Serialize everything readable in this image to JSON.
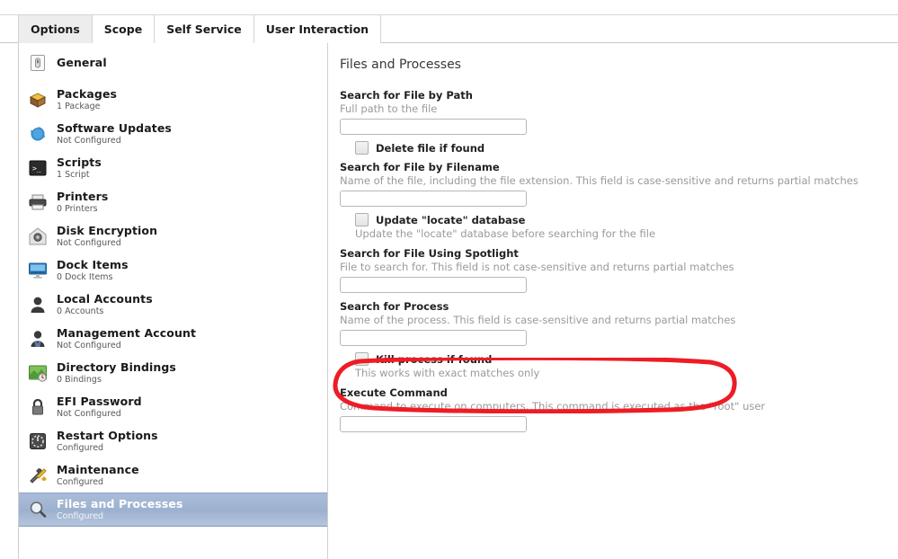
{
  "window": {
    "tabs": [
      {
        "label": "Options",
        "active": true
      },
      {
        "label": "Scope",
        "active": false
      },
      {
        "label": "Self Service",
        "active": false
      },
      {
        "label": "User Interaction",
        "active": false
      }
    ]
  },
  "sidebar": {
    "items": [
      {
        "label": "General",
        "sub": "",
        "icon": "general-icon"
      },
      {
        "label": "Packages",
        "sub": "1 Package",
        "icon": "package-icon"
      },
      {
        "label": "Software Updates",
        "sub": "Not Configured",
        "icon": "software-updates-icon"
      },
      {
        "label": "Scripts",
        "sub": "1 Script",
        "icon": "script-terminal-icon"
      },
      {
        "label": "Printers",
        "sub": "0 Printers",
        "icon": "printer-icon"
      },
      {
        "label": "Disk Encryption",
        "sub": "Not Configured",
        "icon": "disk-encryption-icon"
      },
      {
        "label": "Dock Items",
        "sub": "0 Dock Items",
        "icon": "dock-items-icon"
      },
      {
        "label": "Local Accounts",
        "sub": "0 Accounts",
        "icon": "user-icon"
      },
      {
        "label": "Management Account",
        "sub": "Not Configured",
        "icon": "manager-user-icon"
      },
      {
        "label": "Directory Bindings",
        "sub": "0 Bindings",
        "icon": "directory-bindings-icon"
      },
      {
        "label": "EFI Password",
        "sub": "Not Configured",
        "icon": "lock-icon"
      },
      {
        "label": "Restart Options",
        "sub": "Configured",
        "icon": "restart-options-icon"
      },
      {
        "label": "Maintenance",
        "sub": "Configured",
        "icon": "maintenance-tools-icon"
      },
      {
        "label": "Files and Processes",
        "sub": "Configured",
        "icon": "magnifier-icon",
        "selected": true
      }
    ]
  },
  "main": {
    "title": "Files and Processes",
    "fields": {
      "search_path": {
        "label": "Search for File by Path",
        "help": "Full path to the file",
        "value": "",
        "checkbox_label": "Delete file if found",
        "checkbox_checked": false
      },
      "search_filename": {
        "label": "Search for File by Filename",
        "help": "Name of the file, including the file extension. This field is case-sensitive and returns partial matches",
        "value": "",
        "checkbox_label": "Update \"locate\" database",
        "checkbox_help": "Update the \"locate\" database before searching for the file",
        "checkbox_checked": false
      },
      "search_spotlight": {
        "label": "Search for File Using Spotlight",
        "help": "File to search for. This field is not case-sensitive and returns partial matches",
        "value": ""
      },
      "search_process": {
        "label": "Search for Process",
        "help": "Name of the process. This field is case-sensitive and returns partial matches",
        "value": "",
        "checkbox_label": "Kill process if found",
        "checkbox_help": "This works with exact matches only",
        "checkbox_checked": false
      },
      "execute_command": {
        "label": "Execute Command",
        "help": "Command to execute on computers. This command is executed as the \"root\" user",
        "value": ""
      }
    }
  },
  "annotation": {
    "shape": "ellipse-highlight",
    "target": "Execute Command",
    "color": "#ee1c25"
  }
}
